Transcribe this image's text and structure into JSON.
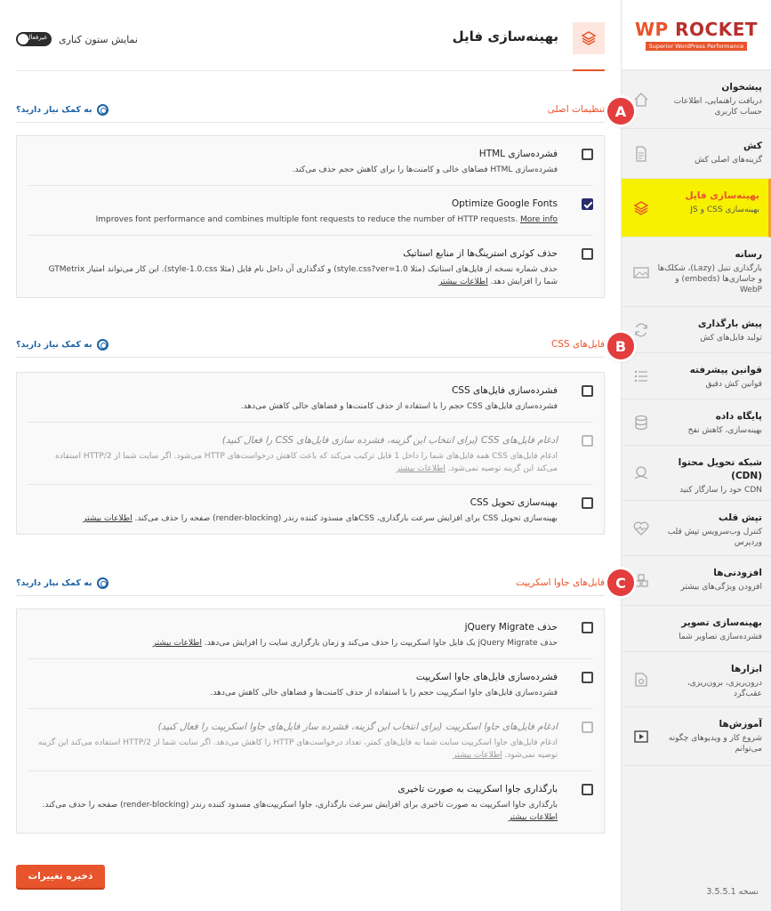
{
  "sidebar": {
    "logo": {
      "wp": "WP",
      "rocket": "ROCKET",
      "tagline": "Superior WordPress Performance"
    },
    "items": [
      {
        "title": "پیشخوان",
        "desc": "دریافت راهنمایی، اطلاعات حساب کاربری",
        "icon": "home-icon"
      },
      {
        "title": "کش",
        "desc": "گزینه‌های اصلی کش",
        "icon": "file-icon"
      },
      {
        "title": "بهینه‌سازی فایل",
        "desc": "بهینه‌سازی CSS و JS",
        "icon": "layers-icon"
      },
      {
        "title": "رسانه",
        "desc": "بارگذاری تنبل (Lazy)، شکلک‌ها و جاسازی‌ها (embeds) و WebP",
        "icon": "image-icon"
      },
      {
        "title": "پیش بارگذاری",
        "desc": "تولید فایل‌های کش",
        "icon": "refresh-icon"
      },
      {
        "title": "قوانین پیشرفته",
        "desc": "قوانین کش دقیق",
        "icon": "list-icon"
      },
      {
        "title": "پایگاه داده",
        "desc": "بهینه‌سازی، کاهش نفخ",
        "icon": "database-icon"
      },
      {
        "title": "شبکه تحویل محتوا (CDN)",
        "desc": "CDN خود را سازگار کنید",
        "icon": "cdn-icon"
      },
      {
        "title": "تپش قلب",
        "desc": "کنترل وب‌سرویس تپش قلب وردپرس",
        "icon": "heartbeat-icon"
      },
      {
        "title": "افزودنی‌ها",
        "desc": "افزودن ویژگی‌های بیشتر",
        "icon": "addons-icon"
      },
      {
        "title": "بهینه‌سازی تصویر",
        "desc": "فشرده‌سازی تصاویر شما",
        "icon": "image-optim-icon"
      },
      {
        "title": "ابزارها",
        "desc": "درون‌ریزی، برون‌ریزی، عقب‌گرد",
        "icon": "tools-icon"
      },
      {
        "title": "آموزش‌ها",
        "desc": "شروع کار و ویدیوهای چگونه می‌توانم",
        "icon": "video-icon"
      }
    ],
    "active_index": 2,
    "version": "نسخه 3.5.5.1"
  },
  "header": {
    "title": "بهینه‌سازی فایل",
    "toggle_label": "نمایش ستون کناری",
    "toggle_state": "غیرفعال"
  },
  "help_label": "به کمک نیاز دارید؟",
  "sections": [
    {
      "marker": "A",
      "title": "تنظیمات اصلی",
      "options": [
        {
          "title": "فشرده‌سازی HTML",
          "desc": "فشرده‌سازی HTML فضاهای خالی و کامنت‌ها را برای کاهش حجم حذف می‌کند.",
          "checked": false,
          "disabled": false
        },
        {
          "title": "Optimize Google Fonts",
          "desc": "Improves font performance and combines multiple font requests to reduce the number of HTTP requests.",
          "more": "More info",
          "checked": true,
          "disabled": false,
          "ltr": true
        },
        {
          "title": "حذف کوئری استرینگ‌ها از منابع استاتیک",
          "desc": "حذف شماره نسخه از فایل‌های استاتیک (مثلا style.css?ver=1.0) و کدگذاری آن داخل نام فایل (مثلا style-1.0.css). این کار می‌تواند امتیاز GTMetrix شما را افزایش دهد.",
          "more": "اطلاعات بیشتر",
          "checked": false,
          "disabled": false
        }
      ]
    },
    {
      "marker": "B",
      "title": "فایل‌های CSS",
      "options": [
        {
          "title": "فشرده‌سازی فایل‌های CSS",
          "desc": "فشرده‌سازی فایل‌های CSS حجم را با استفاده از حذف کامنت‌ها و فضاهای خالی کاهش می‌دهد.",
          "checked": false,
          "disabled": false
        },
        {
          "title": "ادغام فایل‌های CSS (برای انتخاب این گزینه، فشرده سازی فایل‌های CSS را فعال کنید)",
          "desc": "ادغام فایل‌های CSS همه فایل‌های شما را داخل 1 فایل ترکیب می‌کند که باعث کاهش درخواست‌های HTTP می‌شود. اگر سایت شما از HTTP/2 استفاده می‌کند این گزینه توصیه نمی‌شود.",
          "more": "اطلاعات بیشتر",
          "checked": false,
          "disabled": true
        },
        {
          "title": "بهینه‌سازی تحویل CSS",
          "desc": "بهینه‌سازی تحویل CSS برای افزایش سرعت بارگذاری، CSSهای مسدود کننده رندر (render-blocking) صفحه را حذف می‌کند.",
          "more": "اطلاعات بیشتر",
          "checked": false,
          "disabled": false
        }
      ]
    },
    {
      "marker": "C",
      "title": "فایل‌های جاوا اسکریپت",
      "options": [
        {
          "title": "حذف jQuery Migrate",
          "desc": "حذف jQuery Migrate یک فایل جاوا اسکریپت را حذف می‌کند و زمان بارگزاری سایت را افزایش می‌دهد.",
          "more": "اطلاعات بیشتر",
          "checked": false,
          "disabled": false
        },
        {
          "title": "فشرده‌سازی فایل‌های جاوا اسکریپت",
          "desc": "فشرده‌سازی فایل‌های جاوا اسکریپت حجم را با استفاده از حذف کامنت‌ها و فضاهای خالی کاهش می‌دهد.",
          "checked": false,
          "disabled": false
        },
        {
          "title": "ادغام فایل‌های جاوا اسکریپت (برای انتخاب این گزینه، فشرده ساز فایل‌های جاوا اسکریپت را فعال کنید)",
          "desc": "ادغام فایل‌های جاوا اسکریپت سایت شما به فایل‌های کمتر، تعداد درخواست‌های HTTP را کاهش می‌دهد. اگر سایت شما از HTTP/2 استفاده می‌کند این گزینه توصیه نمی‌شود.",
          "more": "اطلاعات بیشتر",
          "checked": false,
          "disabled": true
        },
        {
          "title": "بارگذاری جاوا اسکریپت به صورت تاخیری",
          "desc": "بارگذاری جاوا اسکریپت به صورت تاخیری برای افزایش سرعت بارگذاری، جاوا اسکریپت‌های مسدود کننده رندر (render-blocking) صفحه را حذف می‌کند.",
          "more": "اطلاعات بیشتر",
          "checked": false,
          "disabled": false
        }
      ]
    }
  ],
  "save_label": "ذخیره تغییرات",
  "colors": {
    "accent": "#e8542b",
    "active_nav": "#f7f100",
    "help_link": "#1b62a6",
    "marker": "#e33d3d"
  }
}
